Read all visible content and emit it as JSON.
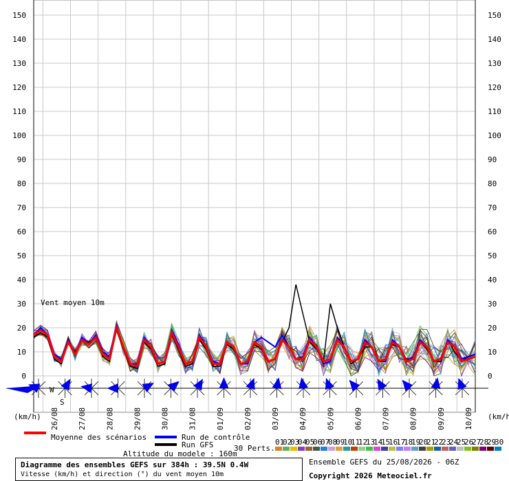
{
  "chart_data": {
    "type": "line",
    "title": "Diagramme des ensembles GEFS sur 384h : 39.5N 0.4W",
    "subtitle": "Vitesse (km/h) et direction (°) du vent moyen 10m",
    "annotation": "Vent moyen 10m",
    "altitude": "Altitude du modele : 160m",
    "run_info": "Ensemble GEFS du 25/08/2026 - 06Z",
    "copyright": "Copyright 2026 Meteociel.fr",
    "ylabel_left": "(km/h)",
    "ylabel_right": "(km/h)",
    "ylim": [
      0,
      155
    ],
    "yticks": [
      0,
      10,
      20,
      30,
      40,
      50,
      60,
      70,
      80,
      90,
      100,
      110,
      120,
      130,
      140,
      150
    ],
    "xlim_hours": [
      0,
      384
    ],
    "dates": [
      "26/08",
      "27/08",
      "28/08",
      "29/08",
      "30/08",
      "31/08",
      "01/09",
      "02/09",
      "03/09",
      "04/09",
      "05/09",
      "06/09",
      "07/09",
      "08/09",
      "09/09",
      "10/09"
    ],
    "grid": true,
    "mean_values": [
      17,
      19,
      17,
      8,
      6,
      14,
      9,
      15,
      13,
      16,
      9,
      7,
      20,
      12,
      5,
      4,
      15,
      12,
      5,
      6,
      18,
      12,
      5,
      6,
      16,
      12,
      5,
      5,
      14,
      12,
      5,
      6,
      14,
      12,
      6,
      7,
      15,
      12,
      7,
      7,
      15,
      12,
      6,
      7,
      15,
      12,
      6,
      7,
      14,
      12,
      6,
      7,
      14,
      12,
      6,
      7,
      14,
      12,
      6,
      7,
      14,
      12,
      6,
      7,
      8
    ],
    "control_values": [
      17,
      20,
      17,
      9,
      7,
      15,
      9,
      16,
      13,
      17,
      10,
      8,
      21,
      12,
      5,
      5,
      16,
      12,
      5,
      6,
      19,
      13,
      5,
      6,
      17,
      12,
      6,
      5,
      14,
      12,
      5,
      5,
      14,
      16,
      14,
      12,
      17,
      12,
      7,
      8,
      16,
      12,
      5,
      6,
      16,
      12,
      6,
      7,
      15,
      12,
      6,
      6,
      15,
      12,
      6,
      8,
      15,
      12,
      6,
      7,
      15,
      12,
      7,
      8,
      9
    ],
    "gfs_values": [
      16,
      18,
      16,
      7,
      5,
      14,
      10,
      15,
      14,
      16,
      8,
      6,
      19,
      11,
      4,
      3,
      14,
      11,
      4,
      5,
      17,
      11,
      4,
      5,
      15,
      11,
      4,
      4,
      13,
      11,
      5,
      6,
      13,
      11,
      6,
      7,
      14,
      20,
      38,
      26,
      14,
      11,
      6,
      30,
      20,
      12,
      5,
      7,
      12,
      12,
      6,
      7,
      13,
      12,
      7,
      7,
      14,
      11,
      6,
      6,
      15,
      10,
      6,
      8,
      9
    ],
    "perturbation_count": 30,
    "series": [
      {
        "name": "Moyenne des scénarios",
        "color": "#ff0000"
      },
      {
        "name": "Run de contrôle",
        "color": "#0000ff"
      },
      {
        "name": "Run GFS",
        "color": "#000000"
      }
    ],
    "perturbations_label": "30 Perts.",
    "perturbation_labels": [
      "01",
      "02",
      "03",
      "04",
      "05",
      "06",
      "07",
      "08",
      "09",
      "10",
      "11",
      "12",
      "13",
      "14",
      "15",
      "16",
      "17",
      "18",
      "19",
      "20",
      "21",
      "22",
      "23",
      "24",
      "25",
      "26",
      "27",
      "28",
      "29",
      "30"
    ],
    "perturbation_colors": [
      "#e08020",
      "#60b060",
      "#e0c000",
      "#8040c0",
      "#a06030",
      "#406040",
      "#2080e0",
      "#d0a0d0",
      "#e0a040",
      "#20a0a0",
      "#c04000",
      "#90d090",
      "#40c040",
      "#e040e0",
      "#4040a0",
      "#c0c040",
      "#8080ff",
      "#c080ff",
      "#60a0c0",
      "#404040",
      "#a0a000",
      "#2060a0",
      "#c06060",
      "#6060c0",
      "#c0c0c0",
      "#80c020",
      "#808000",
      "#800080",
      "#600000",
      "#0080c0"
    ],
    "wind_direction_labels": [
      "W",
      "S"
    ]
  }
}
